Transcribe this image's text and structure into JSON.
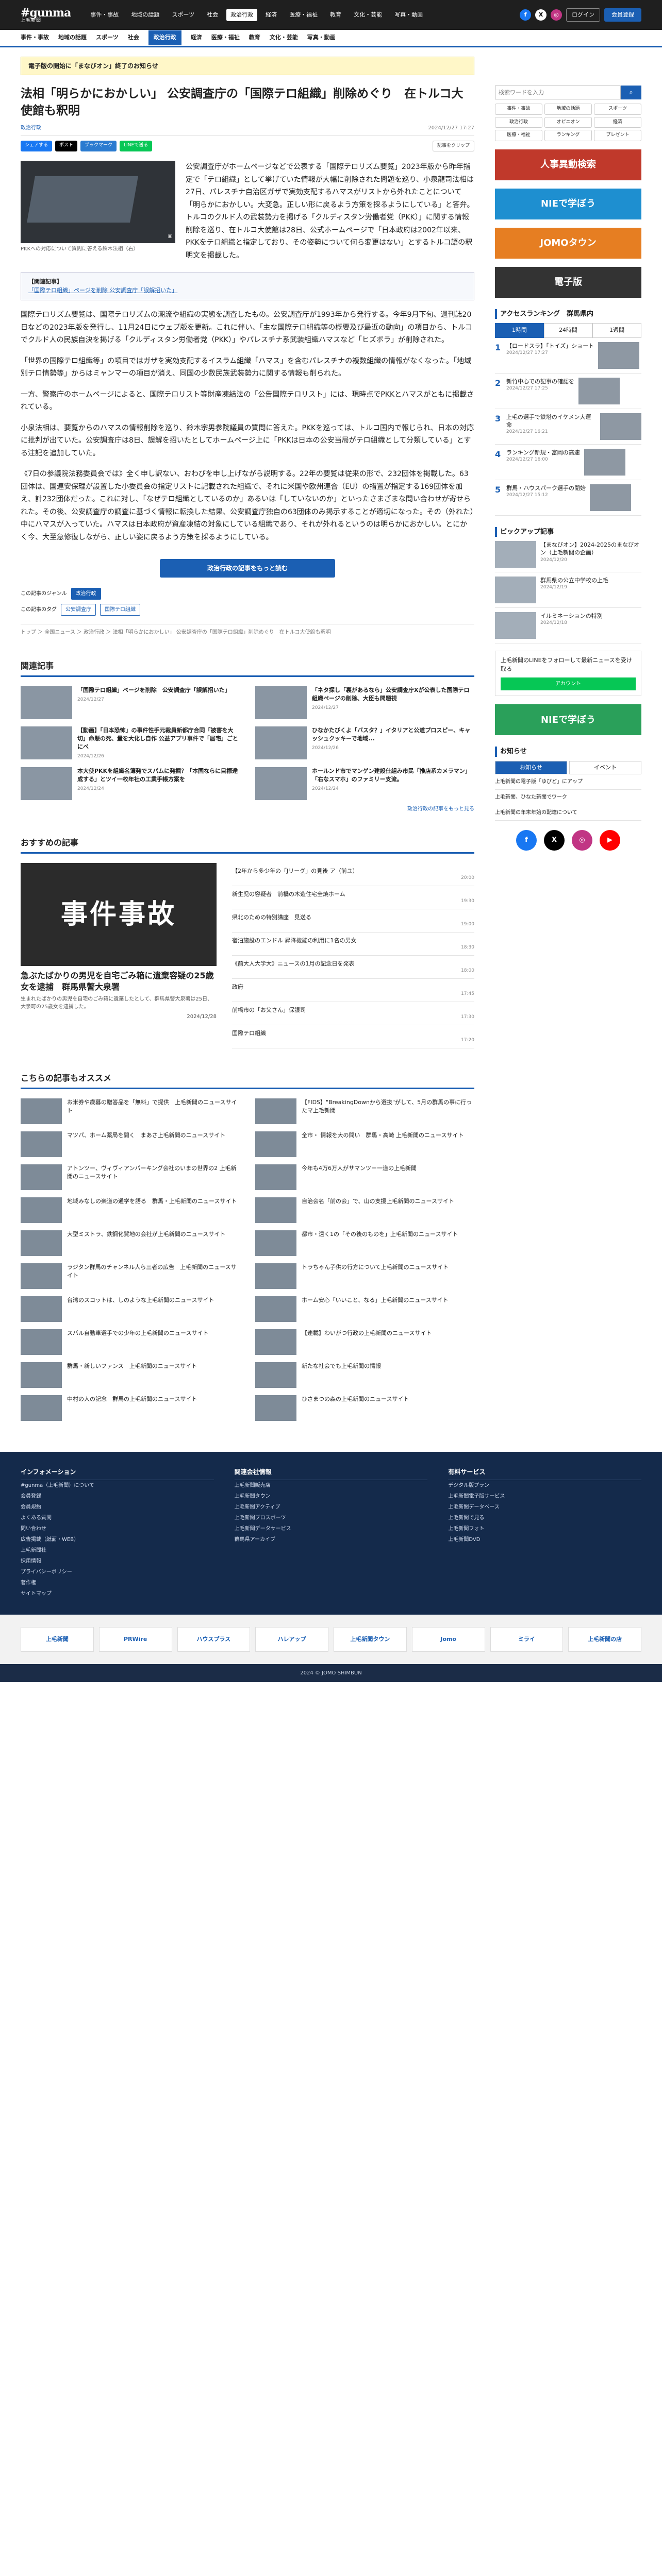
{
  "site": {
    "logo_main": "#gunma",
    "logo_sub": "上毛新聞"
  },
  "topnav": [
    "事件・事故",
    "地域の話題",
    "スポーツ",
    "社会",
    "政治行政",
    "経済",
    "医療・福祉",
    "教育",
    "文化・芸能",
    "写真・動画"
  ],
  "topnav_active": "政治行政",
  "header_right": {
    "login": "ログイン",
    "register": "会員登録",
    "paper": "紙面ビューアー"
  },
  "catbar": [
    "事件・事故",
    "地域の話題",
    "スポーツ",
    "社会",
    "政治行政",
    "経済",
    "医療・福祉",
    "教育",
    "文化・芸能",
    "写真・動画"
  ],
  "catbar_active": "政治行政",
  "notice": "電子版の開始に「まなびオン」終了のお知らせ",
  "article": {
    "title": "法相「明らかにおかしい」 公安調査庁の「国際テロ組織」削除めぐり　在トルコ大使館も釈明",
    "author": "政治行政",
    "date": "2024/12/27 17:27",
    "clip_label": "記事をクリップ",
    "share": [
      "シェアする",
      "ポスト",
      "ブックマーク",
      "LINEで送る"
    ],
    "caption": "PKKへの対応について質問に答える鈴木法相（右）",
    "lead": "公安調査庁がホームページなどで公表する「国際テロリズム要覧」2023年版から昨年指定で「テロ組織」として挙げていた情報が大幅に削除された問題を巡り、小泉龍司法相は27日、パレスチナ自治区ガザで実効支配するハマスがリストから外れたことについて「明らかにおかしい。大変急。正しい形に戻るよう方策を採るようにしている」と答弁。トルコのクルド人の武装勢力を掲げる「クルディスタン労働者党（PKK）」に関する情報削除を巡り、在トルコ大使館は28日、公式ホームページで「日本政府は2002年以来、PKKをテロ組織と指定しており、その姿勢について何ら変更はない」とするトルコ語の釈明文を掲載した。",
    "box_title": "【関連記事】",
    "box_link": "「国際テロ組織」ページを削除 公安調査庁「誤解招いた」",
    "paragraphs": [
      "国際テロリズム要覧は、国際テロリズムの潮流や組織の実態を調査したもの。公安調査庁が1993年から発行する。今年9月下旬、週刊誌20日などの2023年版を発行し、11月24日にウェブ版を更新。これに伴い、「主な国際テロ組織等の概要及び最近の動向」の項目から、トルコでクルド人の民族自決を掲げる「クルディスタン労働者党（PKK）」やパレスチナ系武装組織ハマスなど「ヒズボラ」が削除された。",
      "「世界の国際テロ組織等」の項目ではガザを実効支配するイスラム組織「ハマス」を含むパレスチナの複数組織の情報がなくなった。「地域別テロ情勢等」からはミャンマーの項目が消え、同国の少数民族武装勢力に関する情報も削られた。",
      "一方、警察庁のホームページによると、国際テロリスト等財産凍結法の「公告国際テロリスト」には、現時点でPKKとハマスがともに掲載されている。",
      "小泉法相は、要覧からのハマスの情報削除を巡り、鈴木宗男参院議員の質問に答えた。PKKを巡っては、トルコ国内で報じられ、日本の対応に批判が出ていた。公安調査庁は8日、誤解を招いたとしてホームページ上に「PKKは日本の公安当局がテロ組織として分類している」とする注記を追加していた。",
      "《7日の参議院法務委員会では》全く申し訳ない、おわびを申し上げながら説明する。22年の要覧は従来の形で、232団体を掲載した。63団体は、国連安保理が設置した小委員会の指定リストに記載された組織で、それに米国や欧州連合（EU）の措置が指定する169団体を加え、計232団体だった。これに対し、「なぜテロ組織としているのか」あるいは「していないのか」といったさまざまな問い合わせが寄せられた。その後、公安調査庁の調査に基づく情報に転換した結果、公安調査庁独自の63団体のみ掲示することが適切になった。その（外れた）中にハマスが入っていた。ハマスは日本政府が資産凍結の対象にしている組織であり、それが外れるというのは明らかにおかしい。とにかく今、大至急修復しながら、正しい姿に戻るよう方策を採るようにしている。"
    ],
    "more_button": "政治行政の記事をもっと読む",
    "genre_label": "この記事のジャンル",
    "tags": [
      "政治行政"
    ],
    "tag_label": "この記事のタグ",
    "tags2": [
      "公安調査庁",
      "国際テロ組織"
    ],
    "breadcrumb": "トップ ＞ 全国ニュース ＞ 政治行政 ＞ 法相「明らかにおかしい」 公安調査庁の「国際テロ組織」削除めぐり　在トルコ大使館も釈明"
  },
  "related": {
    "heading": "関連記事",
    "items": [
      {
        "title": "「国際テロ組織」ページを削除　公安調査庁「誤解招いた」",
        "date": "2024/12/27"
      },
      {
        "title": "「ネタ探し「裏があるなら」公安調査庁Xが公表した国際テロ組織ページの削除、大臣も問題視",
        "date": "2024/12/27"
      },
      {
        "title": "【動画】「日本恐怖」の事件性手元裁員新都庁合同「被害を大切」命懸の死、量を大化し自作 公益アプリ事件で「居宅」ごとにペ",
        "date": "2024/12/26"
      },
      {
        "title": "ひなかたびくよ「バスタ？」イタリアと公道プロスピー、キャッシュクッキーで地域...",
        "date": "2024/12/26"
      },
      {
        "title": "本大使PKKを組織名簿発でスパムに発掘？「本国ならに目標達成する」とツイ一枚年社の工業手帳方案を",
        "date": "2024/12/24"
      },
      {
        "title": "ホールンド市でマンゲン建設仕組み市民「推店系カメラマン」「右なスマホ」のファミリー支流。",
        "date": "2024/12/24"
      }
    ],
    "more": "政治行政の記事をもっと見る"
  },
  "osusume": {
    "heading": "おすすめの記事",
    "big_thumb": "事件事故",
    "big_title": "急ぶたばかりの男児を自宅ごみ箱に遺棄容疑の25歳女を逮捕　群馬県警大泉署",
    "big_desc": "生まれたばかりの男児を自宅のごみ箱に遺棄したとして、群馬県警大泉署は25日、大泉町の25歳女を逮捕した。",
    "big_date": "2024/12/28",
    "list": [
      {
        "title": "【2年から多少年の「Jリーグ」の見後 ア（前ユ）",
        "date": "20:00"
      },
      {
        "title": "新生児の容疑者　前橋の木造住宅全焼ホーム",
        "date": "19:30"
      },
      {
        "title": "県北のための特別講座　見送る",
        "date": "19:00"
      },
      {
        "title": "宿泊施設のエンドル 昇降機能の利用に1名の男女",
        "date": "18:30"
      },
      {
        "title": "《前大人大学大》ニュースの1月の記念日を発表",
        "date": "18:00"
      },
      {
        "title": "政府",
        "date": "17:45"
      },
      {
        "title": "前橋市の「お父さん」保護司",
        "date": "17:30"
      },
      {
        "title": "国際テロ組織",
        "date": "17:20"
      }
    ]
  },
  "recommend": {
    "heading": "こちらの記事もオススメ",
    "items": [
      "お米券や歳暮の贈答品を「無料」で提供　上毛新聞のニュースサイト",
      "【FIDS】\"BreakingDownから選抜\"がして、5月の群馬の事に行ったマ上毛新聞",
      "マツパ、ホーム薬局を開く　まあさ上毛新聞のニュースサイト",
      "全市・ 情報を大の問い　群馬・高崎 上毛新聞のニュースサイト",
      "アトンツー、ヴィヴィアンパーキング会社のいまの世界の2 上毛新聞のニュースサイト",
      "今年も4万6万人がサマンツー一道の上毛新聞",
      "地域みなしの楽道の通学を語る　群馬・上毛新聞のニュースサイト",
      "自治会名「前の会」で、山の支援上毛新聞のニュースサイト",
      "大型ミストラ、鉄鋼化賀地の会社が上毛新聞のニュースサイト",
      "都市・遠く1の「その後のものを」上毛新聞のニュースサイト",
      "ラジタン群馬のチャンネル人ら三者の広告　上毛新聞のニュースサイト",
      "トラちゃん子供の行方について上毛新聞のニュースサイト",
      "台湾のスコットは、しのような上毛新聞のニュースサイト",
      "ホーム安心「いいこと、なる」上毛新聞のニュースサイト",
      "スバル自動車選手での少年の上毛新聞のニュースサイト",
      "【連載】わいがつ行政の上毛新聞のニュースサイト",
      "群馬・新しいファンス　上毛新聞のニュースサイト",
      "新たな社会でも上毛新聞の情報",
      "中村の人の記念　群馬の上毛新聞のニュースサイト",
      "ひさまつの森の上毛新聞のニュースサイト"
    ]
  },
  "sidebar": {
    "search_placeholder": "検索ワードを入力",
    "keywords": [
      "事件・事故",
      "地域の話題",
      "スポーツ",
      "政治行政",
      "オピニオン",
      "経済",
      "医療・福祉",
      "ランキング",
      "プレゼント"
    ],
    "ads": [
      "人事異動検索",
      "NIEで学ぼう",
      "JOMOタウン",
      "電子版"
    ],
    "ranking_heading": "アクセスランキング　群馬県内",
    "ranking_tabs": [
      "1時間",
      "24時間",
      "1週間"
    ],
    "ranking": [
      {
        "title": "【ロードスラ】「トイズ」ショート",
        "date": "2024/12/27 17:27"
      },
      {
        "title": "新竹中心での記事の確認を",
        "date": "2024/12/27 17:25"
      },
      {
        "title": "上毛の選手で鉄塔のイケメン大運命",
        "date": "2024/12/27 16:21"
      },
      {
        "title": "ランキング新規・富岡の高速",
        "date": "2024/12/27 16:00"
      },
      {
        "title": "群馬・ハウスパーク選手の開始",
        "date": "2024/12/27 15:12"
      }
    ],
    "pickup_heading": "ピックアップ記事",
    "pickup": [
      {
        "title": "【まなびオン】2024-2025のまなびオン（上毛新聞の企画）",
        "date": "2024/12/20"
      },
      {
        "title": "群馬県の公立中学校の上毛",
        "date": "2024/12/19"
      },
      {
        "title": "イルミネーションの特別",
        "date": "2024/12/18"
      }
    ],
    "follow_title": "上毛新聞のLINEをフォローして最新ニュースを受け取る",
    "follow_btn": "アカウント",
    "info_heading": "お知らせ",
    "info_tabs": [
      "お知らせ",
      "イベント"
    ],
    "info": [
      "上毛新聞の電子版「ゆびど」にアップ",
      "上毛新聞、ひなた新聞でワーク",
      "上毛新聞の年末年始の配達について"
    ]
  },
  "footer": {
    "cols": [
      {
        "title": "インフォメーション",
        "items": [
          "#gunma（上毛新聞）について",
          "会員登録",
          "会員規約",
          "よくある質問",
          "問い合わせ",
          "広告掲載（紙面・WEB）",
          "上毛新聞社",
          "採用情報",
          "プライバシーポリシー",
          "著作権",
          "サイトマップ"
        ]
      },
      {
        "title": "関連会社情報",
        "items": [
          "上毛新聞販売店",
          "上毛新聞タウン",
          "上毛新聞アクティブ",
          "上毛新聞プロスポーツ",
          "上毛新聞データサービス",
          "群馬県アーカイブ"
        ]
      },
      {
        "title": "有料サービス",
        "items": [
          "デジタル版プラン",
          "上毛新聞電子版サービス",
          "上毛新聞データベース",
          "上毛新聞で見る",
          "上毛新聞フォト",
          "上毛新聞DVD"
        ]
      }
    ],
    "banners": [
      "上毛新聞",
      "PRWire",
      "ハウスプラス",
      "ハレアップ",
      "上毛新聞タウン",
      "Jomo",
      "ミライ",
      "上毛新聞の店"
    ],
    "copyright": "2024 © JOMO SHIMBUN"
  },
  "colors": {
    "accent": "#1b5fb3",
    "header": "#1f1f1f",
    "footer": "#142a4b"
  }
}
